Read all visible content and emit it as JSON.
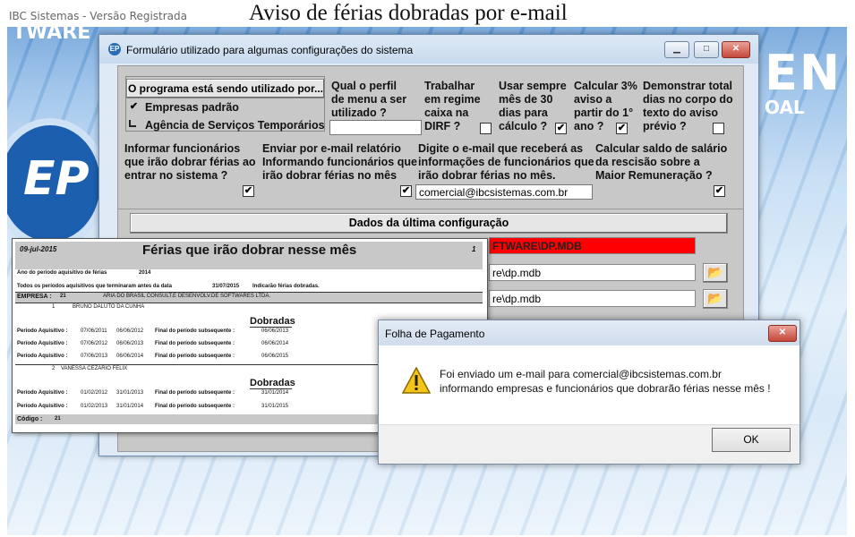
{
  "topbar": {
    "app_label": "IBC Sistemas - Versão Registrada",
    "title": "Aviso de férias dobradas por e-mail"
  },
  "background": {
    "ware_text": "TWARE",
    "logo_text": "EP",
    "right_text": "EN",
    "right_small": "OAL"
  },
  "form_window": {
    "icon_text": "EP",
    "title": "Formulário utilizado para algumas configurações do sistema",
    "minimize": "▁",
    "maximize": "□",
    "close": "✕",
    "usage_group": {
      "button": "O programa está sendo utilizado por...",
      "option1": "Empresas padrão",
      "option2": "Agência de Serviços Temporários",
      "option1_checked": "✔",
      "option2_checked": ""
    },
    "q_perfil_l1": "Qual o perfil",
    "q_perfil_l2": "de menu a ser",
    "q_perfil_l3": "utilizado ?",
    "q_perfil_value": "",
    "q_dirf_l1": "Trabalhar",
    "q_dirf_l2": "em regime",
    "q_dirf_l3": "caixa na",
    "q_dirf_l4": "DIRF ?",
    "q_dirf_check": "",
    "q_30_l1": "Usar sempre",
    "q_30_l2": "mês de 30",
    "q_30_l3": "dias para",
    "q_30_l4": "cálculo ?",
    "q_30_check": "✔",
    "q_3pct_l1": "Calcular 3%",
    "q_3pct_l2": "aviso a",
    "q_3pct_l3": "partir do 1°",
    "q_3pct_l4": "ano ?",
    "q_3pct_check": "✔",
    "q_total_l1": "Demonstrar total",
    "q_total_l2": "dias no corpo do",
    "q_total_l3": "texto do aviso",
    "q_total_l4": "prévio ?",
    "q_total_check": "",
    "q_inform_l1": "Informar funcionários",
    "q_inform_l2": "que irão dobrar férias  ao",
    "q_inform_l3": "entrar no sistema ?",
    "q_inform_check": "✔",
    "q_email_l1": "Enviar por e-mail relatório",
    "q_email_l2": "Informando funcionários que",
    "q_email_l3": "irão dobrar férias  no mês",
    "q_email_check": "✔",
    "q_addr_l1": "Digite o e-mail que receberá as",
    "q_addr_l2": "informações de funcionários que",
    "q_addr_l3": "irão dobrar férias no mês.",
    "email_value": "comercial@ibcsistemas.com.br",
    "q_saldo_l1": "Calcular saldo de salário",
    "q_saldo_l2": "da rescisão sobre a",
    "q_saldo_l3": "Maior Remuneração ?",
    "q_saldo_check": "✔",
    "last_config_button": "Dados da última configuração",
    "paths": [
      "FTWARE\\DP.MDB",
      "re\\dp.mdb",
      "re\\dp.mdb"
    ],
    "folder_icon": "📂"
  },
  "report": {
    "date": "09-jul-2015",
    "title": "Férias que irão dobrar nesse mês",
    "page": "1",
    "line1_label": "Ano do período aquisitivo de férias",
    "line1_value": "2014",
    "line2_label": "Todos os períodos aquisitivos que terminaram antes da data",
    "line2_date": "31/07/2015",
    "line2_note": "Indicarão férias dobradas.",
    "company_label": "EMPRESA :",
    "company_code": "21",
    "company_name": "ARIA DO BRASIL CONSULT.E DESENVOLV.DE SOFTWARES LTDA.",
    "dobradas": "Dobradas",
    "employees": [
      {
        "num": "1",
        "name": "BRUNO DALUTO DA CUNHA",
        "periods": [
          {
            "label": "Período Aquisitivo :",
            "start": "07/06/2011",
            "end": "06/06/2012",
            "next": "Final do período subsequente :",
            "due": "06/06/2013"
          },
          {
            "label": "Período Aquisitivo :",
            "start": "07/06/2012",
            "end": "06/06/2013",
            "next": "Final do período subsequente :",
            "due": "06/06/2014"
          },
          {
            "label": "Período Aquisitivo :",
            "start": "07/06/2013",
            "end": "06/06/2014",
            "next": "Final do período subsequente :",
            "due": "06/06/2015"
          }
        ]
      },
      {
        "num": "2",
        "name": "VANESSA CEZÁRIO FELIX",
        "periods": [
          {
            "label": "Período Aquisitivo :",
            "start": "01/02/2012",
            "end": "31/01/2013",
            "next": "Final do período subsequente :",
            "due": "31/01/2014"
          },
          {
            "label": "Período Aquisitivo :",
            "start": "01/02/2013",
            "end": "31/01/2014",
            "next": "Final do período subsequente :",
            "due": "31/01/2015"
          }
        ]
      }
    ],
    "footer_label": "Código  :",
    "footer_code": "21"
  },
  "dialog": {
    "title": "Folha de Pagamento",
    "close": "✕",
    "message_l1": "Foi enviado um e-mail para comercial@ibcsistemas.com.br",
    "message_l2": "informando empresas e funcionários que dobrarão férias nesse mês !",
    "ok": "OK"
  }
}
